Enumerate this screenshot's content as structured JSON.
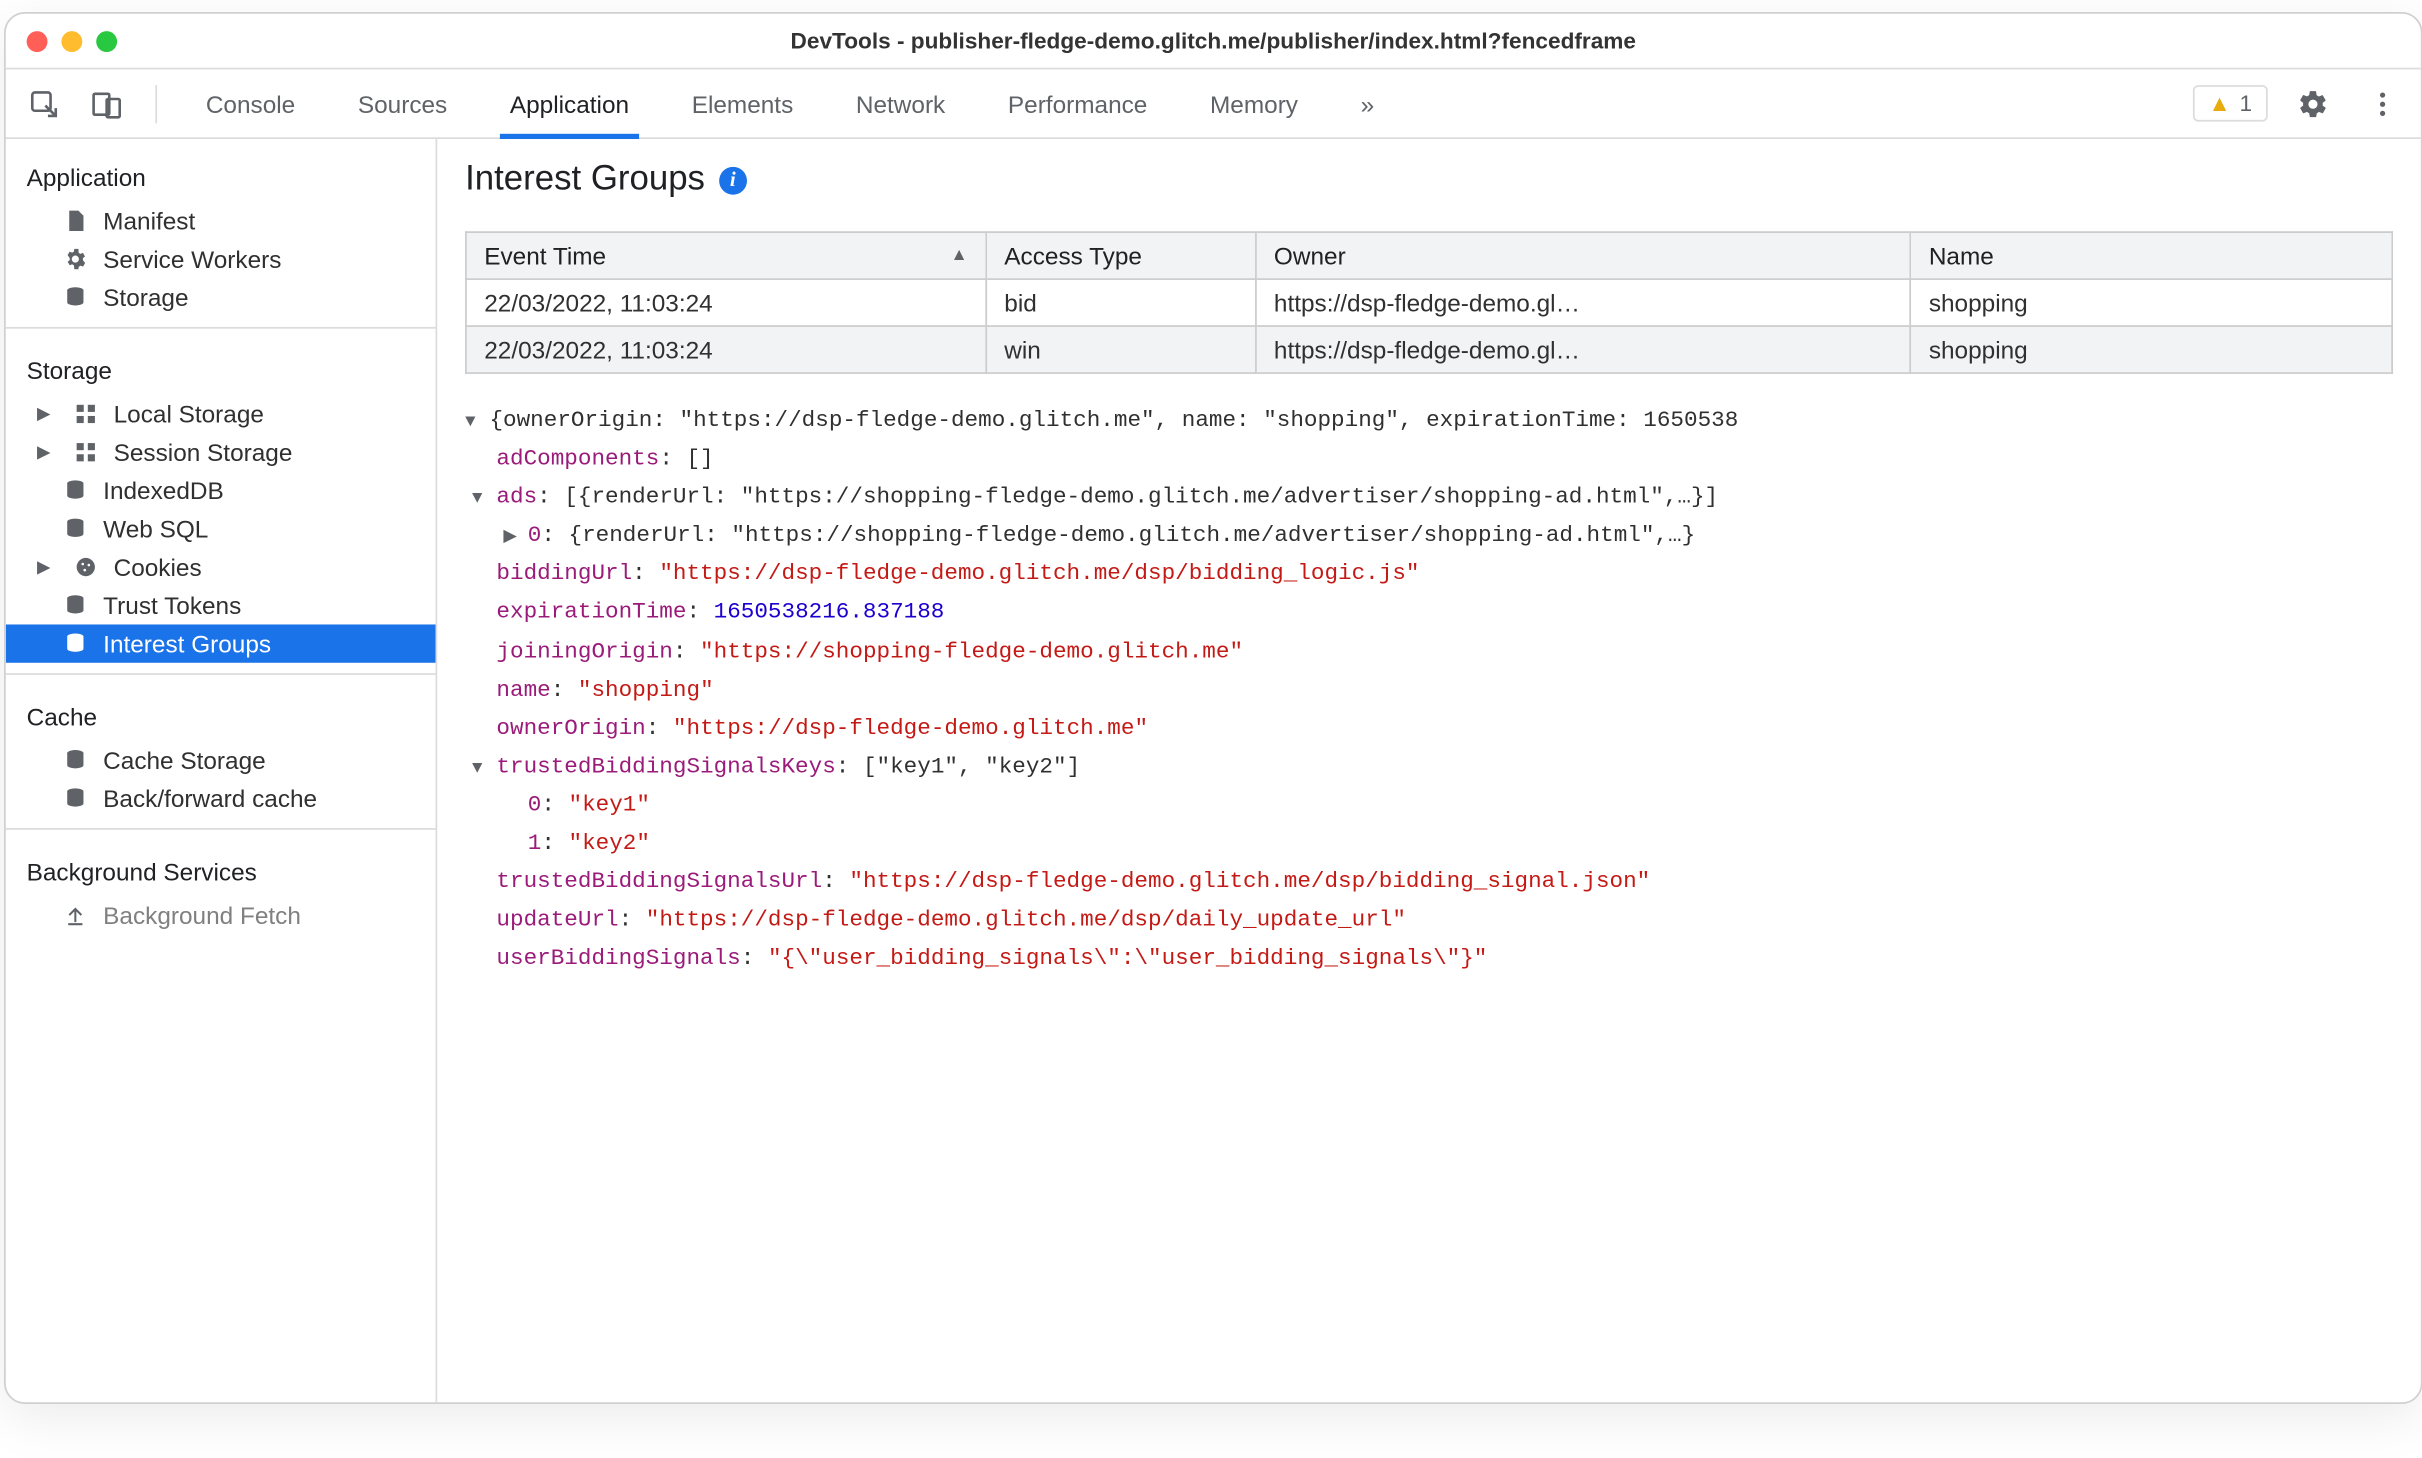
{
  "window": {
    "title": "DevTools - publisher-fledge-demo.glitch.me/publisher/index.html?fencedframe"
  },
  "toolbar": {
    "tabs": [
      "Console",
      "Sources",
      "Application",
      "Elements",
      "Network",
      "Performance",
      "Memory"
    ],
    "active_tab": "Application",
    "more_glyph": "»",
    "warning_count": "1"
  },
  "sidebar": {
    "groups": [
      {
        "heading": "Application",
        "items": [
          {
            "label": "Manifest",
            "icon": "file-icon"
          },
          {
            "label": "Service Workers",
            "icon": "gear-icon"
          },
          {
            "label": "Storage",
            "icon": "database-icon"
          }
        ]
      },
      {
        "heading": "Storage",
        "items": [
          {
            "label": "Local Storage",
            "icon": "grid-icon",
            "caret": true
          },
          {
            "label": "Session Storage",
            "icon": "grid-icon",
            "caret": true
          },
          {
            "label": "IndexedDB",
            "icon": "database-icon"
          },
          {
            "label": "Web SQL",
            "icon": "database-icon"
          },
          {
            "label": "Cookies",
            "icon": "cookie-icon",
            "caret": true
          },
          {
            "label": "Trust Tokens",
            "icon": "database-icon"
          },
          {
            "label": "Interest Groups",
            "icon": "database-icon",
            "selected": true
          }
        ]
      },
      {
        "heading": "Cache",
        "items": [
          {
            "label": "Cache Storage",
            "icon": "database-icon"
          },
          {
            "label": "Back/forward cache",
            "icon": "database-icon",
            "truncate": true
          }
        ]
      },
      {
        "heading": "Background Services",
        "items": [
          {
            "label": "Background Fetch",
            "icon": "upload-icon",
            "truncate": true
          }
        ]
      }
    ]
  },
  "panel": {
    "title": "Interest Groups",
    "columns": [
      "Event Time",
      "Access Type",
      "Owner",
      "Name"
    ],
    "rows": [
      {
        "time": "22/03/2022, 11:03:24",
        "type": "bid",
        "owner": "https://dsp-fledge-demo.gl…",
        "name": "shopping"
      },
      {
        "time": "22/03/2022, 11:03:24",
        "type": "win",
        "owner": "https://dsp-fledge-demo.gl…",
        "name": "shopping"
      }
    ]
  },
  "detail": {
    "summary": "{ownerOrigin: \"https://dsp-fledge-demo.glitch.me\", name: \"shopping\", expirationTime: 1650538",
    "adComponents": "[]",
    "ads_summary": "[{renderUrl: \"https://shopping-fledge-demo.glitch.me/advertiser/shopping-ad.html\",…}]",
    "ads_0": "{renderUrl: \"https://shopping-fledge-demo.glitch.me/advertiser/shopping-ad.html\",…}",
    "biddingUrl": "\"https://dsp-fledge-demo.glitch.me/dsp/bidding_logic.js\"",
    "expirationTime": "1650538216.837188",
    "joiningOrigin": "\"https://shopping-fledge-demo.glitch.me\"",
    "name": "\"shopping\"",
    "ownerOrigin": "\"https://dsp-fledge-demo.glitch.me\"",
    "tbsk_summary": "[\"key1\", \"key2\"]",
    "tbsk_0": "\"key1\"",
    "tbsk_1": "\"key2\"",
    "trustedBiddingSignalsUrl": "\"https://dsp-fledge-demo.glitch.me/dsp/bidding_signal.json\"",
    "updateUrl": "\"https://dsp-fledge-demo.glitch.me/dsp/daily_update_url\"",
    "userBiddingSignals": "\"{\\\"user_bidding_signals\\\":\\\"user_bidding_signals\\\"}\""
  }
}
